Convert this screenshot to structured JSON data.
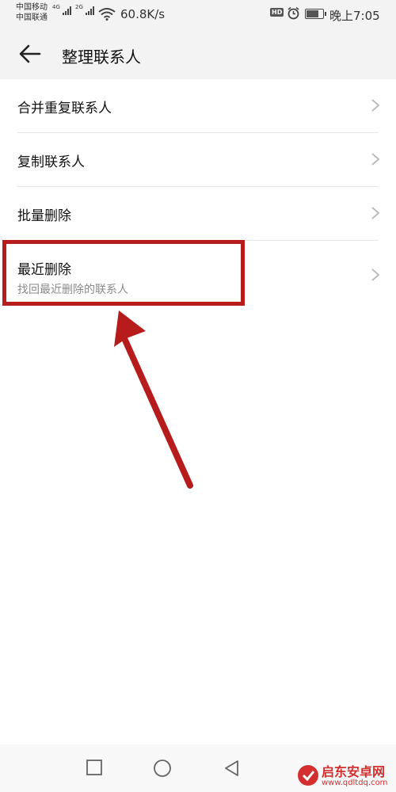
{
  "status_bar": {
    "carrier_1": "中国移动",
    "carrier_2": "中国联通",
    "net_1": "4G",
    "net_2": "2G",
    "speed": "60.8K/s",
    "hd": "HD",
    "time": "晚上7:05"
  },
  "app_bar": {
    "title": "整理联系人"
  },
  "items": [
    {
      "label": "合并重复联系人"
    },
    {
      "label": "复制联系人"
    },
    {
      "label": "批量删除"
    },
    {
      "label": "最近删除",
      "sub": "找回最近删除的联系人"
    }
  ],
  "watermark": {
    "name": "启东安卓网",
    "url": "www.qdltdq.com"
  },
  "colors": {
    "annotation": "#b71c1c",
    "background": "#ffffff",
    "bar_background": "#f3f3f3"
  }
}
